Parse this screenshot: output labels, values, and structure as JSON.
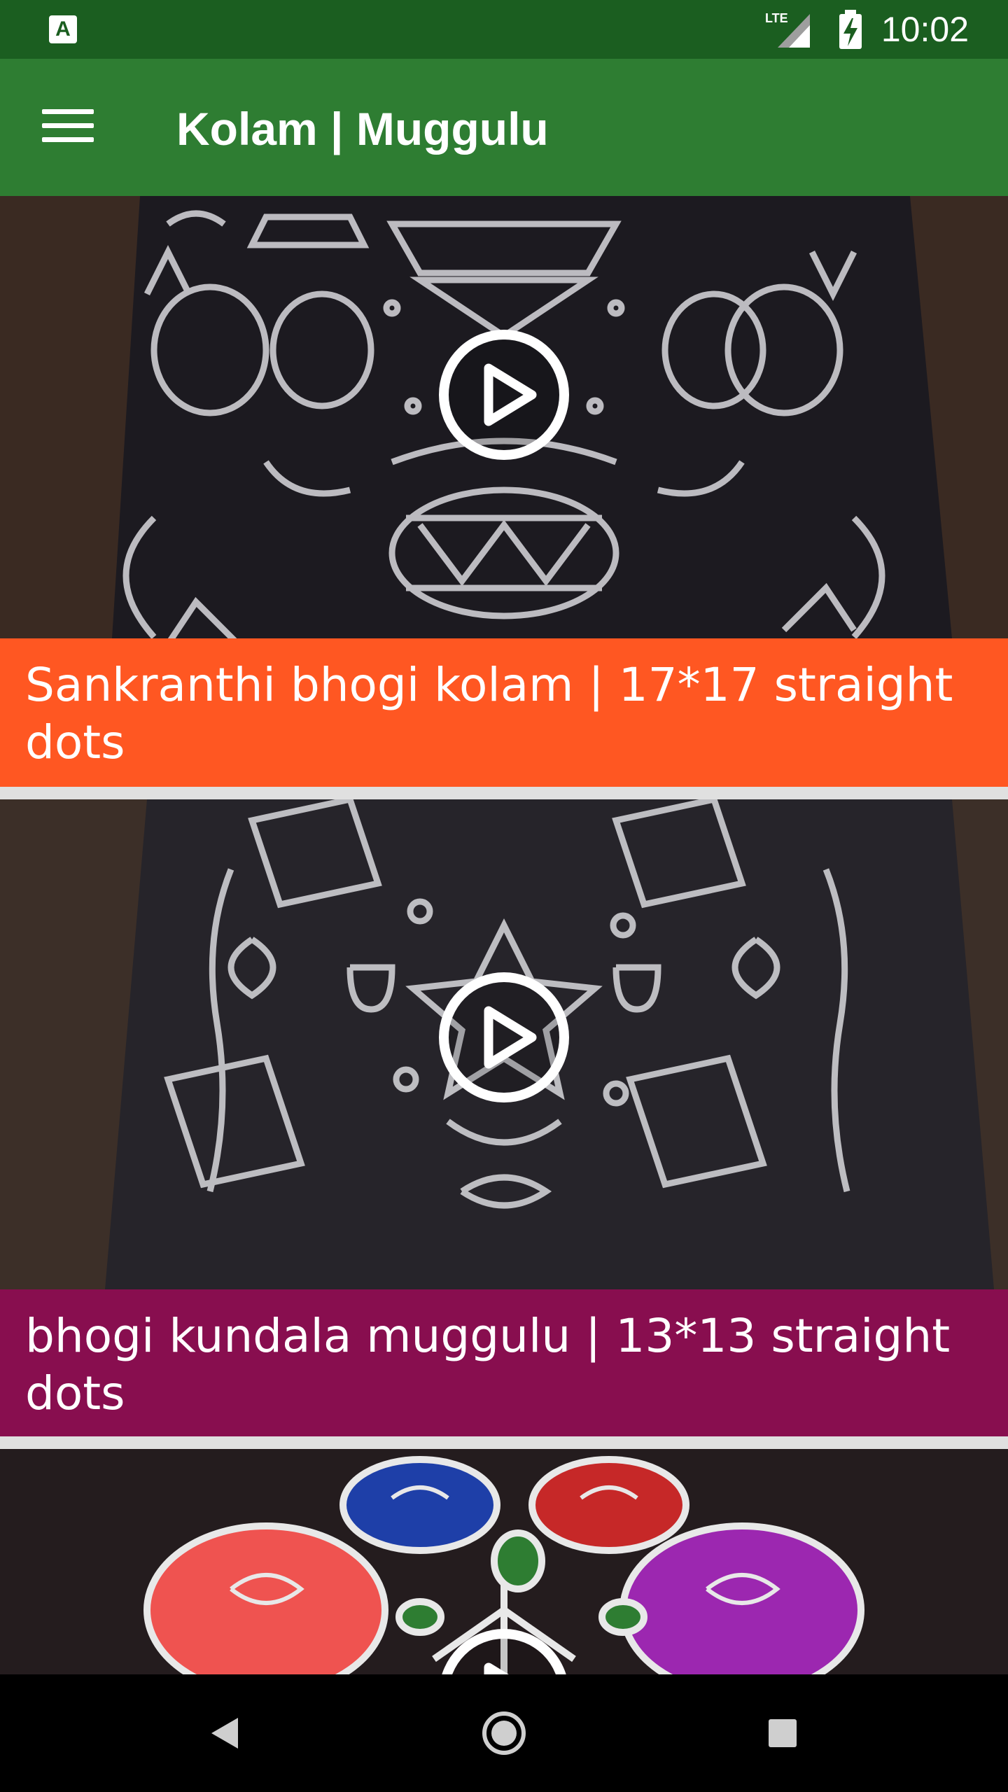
{
  "status_bar": {
    "time": "10:02",
    "network": "LTE",
    "app_icon_letter": "A",
    "icons": [
      "app-notification-icon",
      "lte-signal-icon",
      "battery-charging-icon"
    ]
  },
  "app_bar": {
    "title": "Kolam | Muggulu",
    "menu_icon": "hamburger-menu-icon"
  },
  "videos": [
    {
      "title": "Sankranthi bhogi kolam | 17*17 straight dots",
      "subtitle": "...",
      "caption_color": "#ff5722",
      "thumbnail": "white kolam on black floor"
    },
    {
      "title": "bhogi kundala muggulu | 13*13 straight dots",
      "subtitle": "...",
      "caption_color": "#880e4f",
      "thumbnail": "white kolam on black floor"
    },
    {
      "title": "",
      "thumbnail": "colorful flower rangoli"
    }
  ],
  "nav_bar": {
    "icons": [
      "back-icon",
      "home-icon",
      "recents-icon"
    ]
  },
  "colors": {
    "status_bar": "#1b5e20",
    "app_bar": "#2e7d32"
  }
}
